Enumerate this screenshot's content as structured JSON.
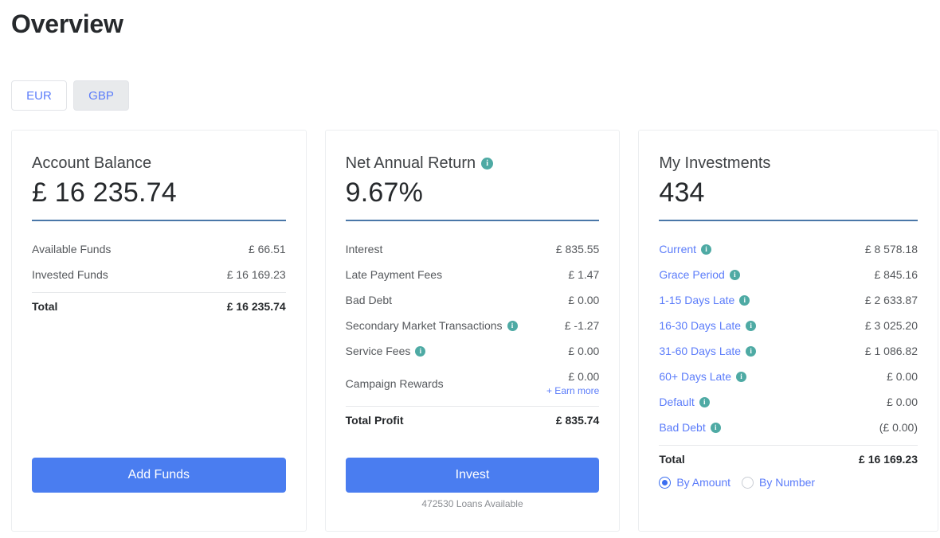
{
  "page": {
    "title": "Overview"
  },
  "currency_toggle": {
    "options": [
      {
        "label": "EUR",
        "active": false
      },
      {
        "label": "GBP",
        "active": true
      }
    ]
  },
  "cards": {
    "account_balance": {
      "title": "Account Balance",
      "headline": "£ 16 235.74",
      "rows": [
        {
          "label": "Available Funds",
          "value": "£ 66.51"
        },
        {
          "label": "Invested Funds",
          "value": "£ 16 169.23"
        }
      ],
      "total": {
        "label": "Total",
        "value": "£ 16 235.74"
      },
      "cta": {
        "label": "Add Funds"
      }
    },
    "net_annual_return": {
      "title": "Net Annual Return",
      "title_info_icon": "info-icon",
      "headline": "9.67%",
      "rows": [
        {
          "label": "Interest",
          "value": "£ 835.55",
          "info": false
        },
        {
          "label": "Late Payment Fees",
          "value": "£ 1.47",
          "info": false
        },
        {
          "label": "Bad Debt",
          "value": "£ 0.00",
          "info": false
        },
        {
          "label": "Secondary Market Transactions",
          "value": "£ -1.27",
          "info": true
        },
        {
          "label": "Service Fees",
          "value": "£ 0.00",
          "info": true
        }
      ],
      "campaign_rewards": {
        "label": "Campaign Rewards",
        "value": "£ 0.00",
        "link": "+ Earn more"
      },
      "total": {
        "label": "Total Profit",
        "value": "£ 835.74"
      },
      "cta": {
        "label": "Invest"
      },
      "cta_note": "472530 Loans Available"
    },
    "my_investments": {
      "title": "My Investments",
      "headline": "434",
      "rows": [
        {
          "label": "Current",
          "value": "£ 8 578.18",
          "info": true
        },
        {
          "label": "Grace Period",
          "value": "£ 845.16",
          "info": true
        },
        {
          "label": "1-15 Days Late",
          "value": "£ 2 633.87",
          "info": true
        },
        {
          "label": "16-30 Days Late",
          "value": "£ 3 025.20",
          "info": true
        },
        {
          "label": "31-60 Days Late",
          "value": "£ 1 086.82",
          "info": true
        },
        {
          "label": "60+ Days Late",
          "value": "£ 0.00",
          "info": true
        },
        {
          "label": "Default",
          "value": "£ 0.00",
          "info": true
        },
        {
          "label": "Bad Debt",
          "value": "(£ 0.00)",
          "info": true
        }
      ],
      "total": {
        "label": "Total",
        "value": "£ 16 169.23"
      },
      "view_mode": {
        "options": [
          {
            "label": "By Amount",
            "selected": true
          },
          {
            "label": "By Number",
            "selected": false
          }
        ]
      }
    }
  },
  "colors": {
    "accent_blue": "#4a7df0",
    "link_blue": "#5b7cfa",
    "rule_blue": "#4a77a8",
    "info_teal": "#4eaaa4",
    "text_dark": "#26292c",
    "text_muted": "#55585c"
  }
}
